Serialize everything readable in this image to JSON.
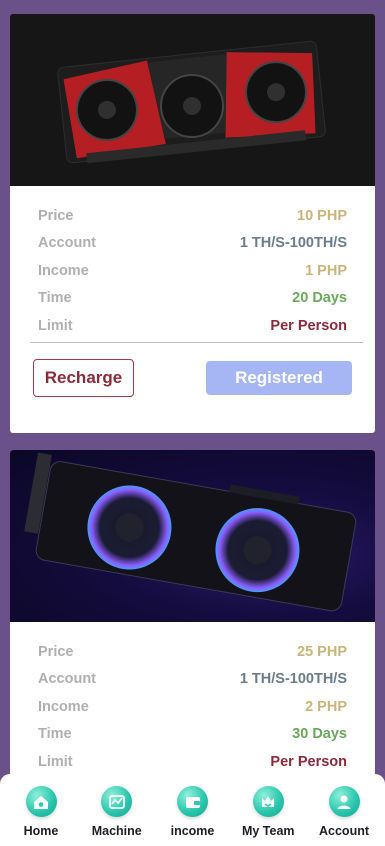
{
  "products": [
    {
      "image_icon": "graphics-card-red-image",
      "rows": [
        {
          "label": "Price",
          "value": "10 PHP"
        },
        {
          "label": "Account",
          "value": "1 TH/S-100TH/S"
        },
        {
          "label": "Income",
          "value": "1 PHP"
        },
        {
          "label": "Time",
          "value": "20 Days"
        },
        {
          "label": "Limit",
          "value": "Per Person"
        }
      ],
      "recharge_label": "Recharge",
      "status_label": "Registered"
    },
    {
      "image_icon": "graphics-card-arc-image",
      "rows": [
        {
          "label": "Price",
          "value": "25 PHP"
        },
        {
          "label": "Account",
          "value": "1 TH/S-100TH/S"
        },
        {
          "label": "Income",
          "value": "2 PHP"
        },
        {
          "label": "Time",
          "value": "30 Days"
        },
        {
          "label": "Limit",
          "value": "Per Person"
        }
      ]
    }
  ],
  "nav": [
    {
      "label": "Home",
      "icon": "home-icon"
    },
    {
      "label": "Machine",
      "icon": "machine-icon"
    },
    {
      "label": "income",
      "icon": "wallet-icon"
    },
    {
      "label": "My Team",
      "icon": "team-icon"
    },
    {
      "label": "Account",
      "icon": "person-icon"
    }
  ],
  "colors": {
    "background": "#6b5189",
    "price": "#c9b579",
    "account": "#6b7d8c",
    "time": "#6aa85b",
    "limit": "#8b2a3a",
    "registered_button": "#a6b6f5",
    "nav_icon": "#2cc7ae"
  }
}
